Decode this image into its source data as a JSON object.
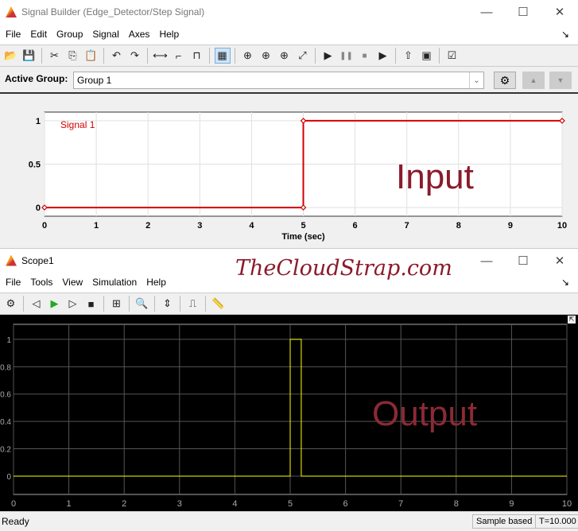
{
  "signal_builder": {
    "title": "Signal Builder (Edge_Detector/Step Signal)",
    "menu": [
      "File",
      "Edit",
      "Group",
      "Signal",
      "Axes",
      "Help"
    ],
    "toolbar_icons": [
      "open-icon",
      "save-icon",
      "|",
      "cut-icon",
      "copy-icon",
      "paste-icon",
      "|",
      "undo-icon",
      "redo-icon",
      "|",
      "segment-icon",
      "step-up-icon",
      "pulse-icon",
      "|",
      "grid-icon",
      "|",
      "zoom-x-icon",
      "zoom-y-icon",
      "zoom-xy-icon",
      "fit-icon",
      "|",
      "play-icon",
      "pause-icon",
      "stop-icon",
      "run-all-icon",
      "|",
      "up-arrow-icon",
      "show-block-icon",
      "|",
      "verification-icon"
    ],
    "active_group_label": "Active Group:",
    "active_group_value": "Group 1",
    "overlay_label": "Input"
  },
  "chart_data": [
    {
      "type": "line",
      "xlabel": "Time (sec)",
      "ylabel": "",
      "xlim": [
        0,
        10
      ],
      "ylim": [
        -0.1,
        1.1
      ],
      "xticks": [
        "0",
        "1",
        "2",
        "3",
        "4",
        "5",
        "6",
        "7",
        "8",
        "9",
        "10"
      ],
      "yticks": [
        "0",
        "0.5",
        "1"
      ],
      "grid": true,
      "series": [
        {
          "name": "Signal 1",
          "color": "#d40000",
          "x": [
            0,
            5,
            5,
            10
          ],
          "y": [
            0,
            0,
            1,
            1
          ]
        }
      ]
    },
    {
      "type": "line",
      "xlabel": "",
      "ylabel": "",
      "xlim": [
        0,
        10
      ],
      "ylim": [
        -0.134,
        1.11
      ],
      "xticks": [
        "0",
        "1",
        "2",
        "3",
        "4",
        "5",
        "6",
        "7",
        "8",
        "9",
        "10"
      ],
      "yticks": [
        "0",
        "0.2",
        "0.4",
        "0.6",
        "0.8",
        "1"
      ],
      "grid": true,
      "series": [
        {
          "color": "#ffff00",
          "x": [
            0,
            5,
            5,
            5.2,
            5.2,
            10
          ],
          "y": [
            0,
            0,
            1,
            1,
            0,
            0
          ]
        }
      ]
    }
  ],
  "scope": {
    "title": "Scope1",
    "menu": [
      "File",
      "Tools",
      "View",
      "Simulation",
      "Help"
    ],
    "toolbar_icons": [
      "settings-icon",
      "|",
      "step-back-icon",
      "run-icon",
      "step-forward-icon",
      "stop-icon",
      "|",
      "highlight-icon",
      "|",
      "zoom-icon",
      "|",
      "autoscale-icon",
      "|",
      "trigger-icon",
      "|",
      "measure-icon"
    ],
    "overlay_label": "Output",
    "status": "Ready",
    "sample_mode": "Sample based",
    "time": "T=10.000"
  },
  "watermark": "TheCloudStrap.com"
}
